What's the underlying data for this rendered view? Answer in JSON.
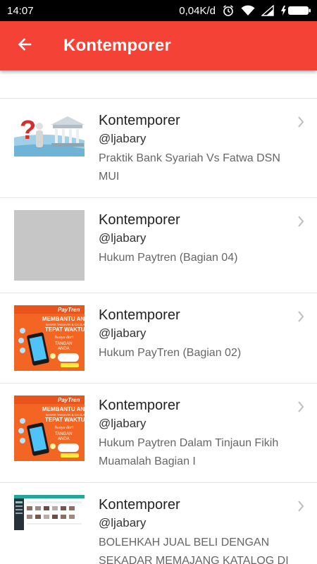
{
  "status_bar": {
    "time": "14:07",
    "network_speed": "0,04K/d",
    "icons": [
      "alarm-icon",
      "wifi-icon",
      "signal-icon",
      "battery-charging-icon"
    ]
  },
  "app_bar": {
    "title": "Kontemporer",
    "back_icon": "arrow-back-icon",
    "color": "#f44336"
  },
  "items": [
    {
      "title": "Kontemporer",
      "handle": "@ljabary",
      "description": "Praktik Bank Syariah Vs Fatwa DSN MUI",
      "thumbnail": "bank-syariah-question-image"
    },
    {
      "title": "Kontemporer",
      "handle": "@ljabary",
      "description": "Hukum Paytren (Bagian 04)",
      "thumbnail": "gray-placeholder-image"
    },
    {
      "title": "Kontemporer",
      "handle": "@ljabary",
      "description": "Hukum PayTren (Bagian 02)",
      "thumbnail": "paytren-promo-image"
    },
    {
      "title": "Kontemporer",
      "handle": "@ljabary",
      "description": "Hukum Paytren Dalam Tinjaun Fikih Muamalah Bagian I",
      "thumbnail": "paytren-promo-image"
    },
    {
      "title": "Kontemporer",
      "handle": "@ljabary",
      "description": "BOLEHKAH JUAL BELI DENGAN SEKADAR MEMAJANG KATALOG DI",
      "thumbnail": "catalog-screenshot-image"
    }
  ]
}
